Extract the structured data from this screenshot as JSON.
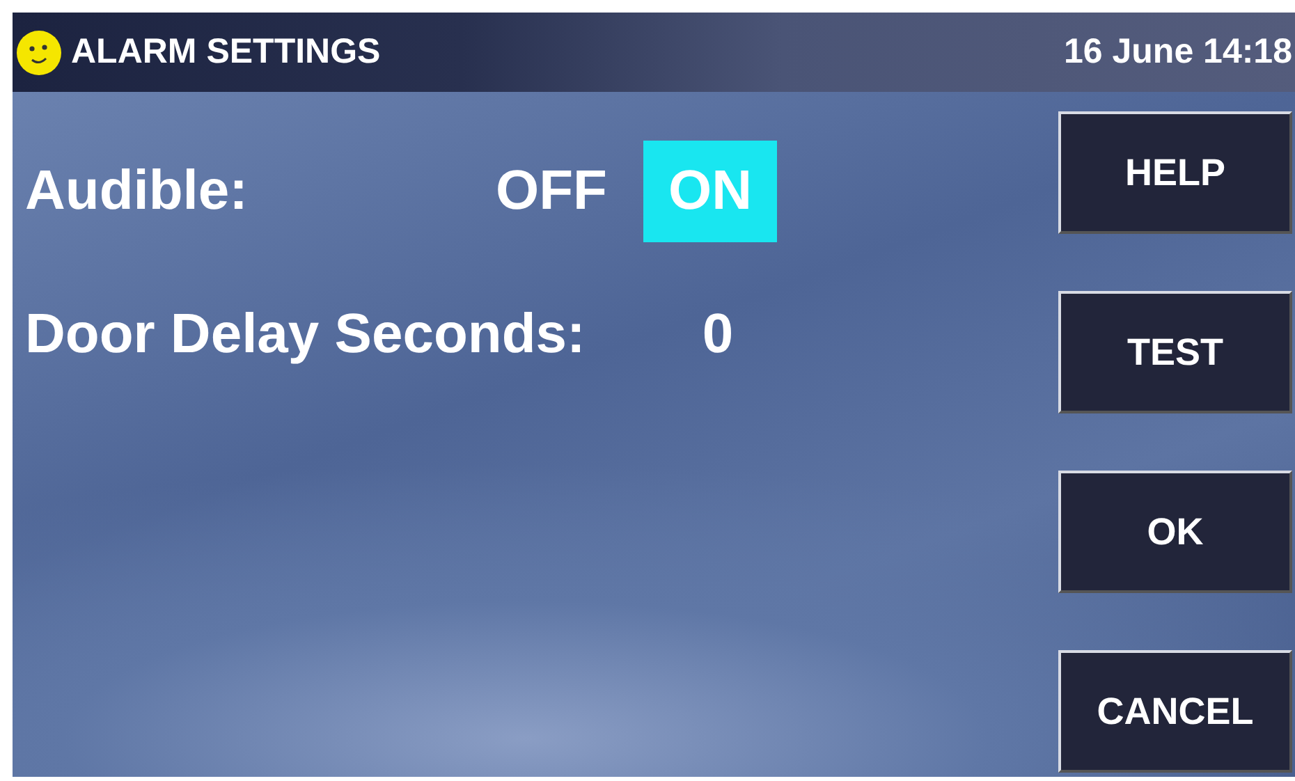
{
  "header": {
    "title": "ALARM SETTINGS",
    "datetime": "16 June 14:18"
  },
  "settings": [
    {
      "kind": "toggle",
      "label": "Audible:",
      "options": [
        {
          "label": "OFF",
          "selected": false
        },
        {
          "label": "ON",
          "selected": true
        }
      ]
    },
    {
      "kind": "value",
      "label": "Door Delay Seconds:",
      "value": "0"
    }
  ],
  "buttons": [
    "HELP",
    "TEST",
    "OK",
    "CANCEL"
  ]
}
